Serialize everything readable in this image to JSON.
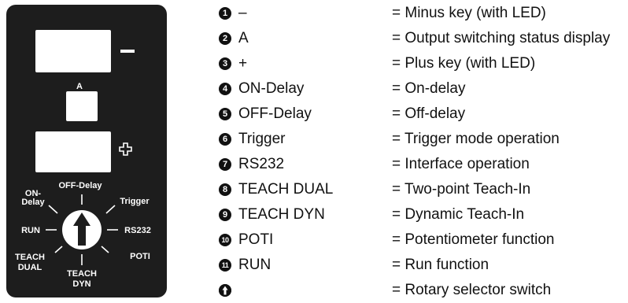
{
  "panel": {
    "display_a_label": "A",
    "minus_symbol": "–",
    "dial_labels": {
      "on_delay_1": "ON-",
      "on_delay_2": "Delay",
      "off_delay": "OFF-Delay",
      "trigger": "Trigger",
      "run": "RUN",
      "rs232": "RS232",
      "teach_dual_1": "TEACH",
      "teach_dual_2": "DUAL",
      "poti": "POTI",
      "teach_dyn_1": "TEACH",
      "teach_dyn_2": "DYN"
    }
  },
  "legend": [
    {
      "n": "1",
      "key": "–",
      "desc": "= Minus key (with LED)"
    },
    {
      "n": "2",
      "key": "A",
      "desc": "= Output switching status display"
    },
    {
      "n": "3",
      "key": "+",
      "desc": "= Plus key (with LED)"
    },
    {
      "n": "4",
      "key": "ON-Delay",
      "desc": "= On-delay"
    },
    {
      "n": "5",
      "key": "OFF-Delay",
      "desc": "= Off-delay"
    },
    {
      "n": "6",
      "key": "Trigger",
      "desc": "= Trigger mode operation"
    },
    {
      "n": "7",
      "key": "RS232",
      "desc": "= Interface operation"
    },
    {
      "n": "8",
      "key": "TEACH DUAL",
      "desc": "= Two-point Teach-In"
    },
    {
      "n": "9",
      "key": "TEACH DYN",
      "desc": "= Dynamic Teach-In"
    },
    {
      "n": "10",
      "key": "POTI",
      "desc": "= Potentiometer function"
    },
    {
      "n": "11",
      "key": "RUN",
      "desc": "= Run function"
    },
    {
      "n": "",
      "key": "",
      "desc": "= Rotary selector switch",
      "icon": "rotary-arrow-icon"
    }
  ]
}
